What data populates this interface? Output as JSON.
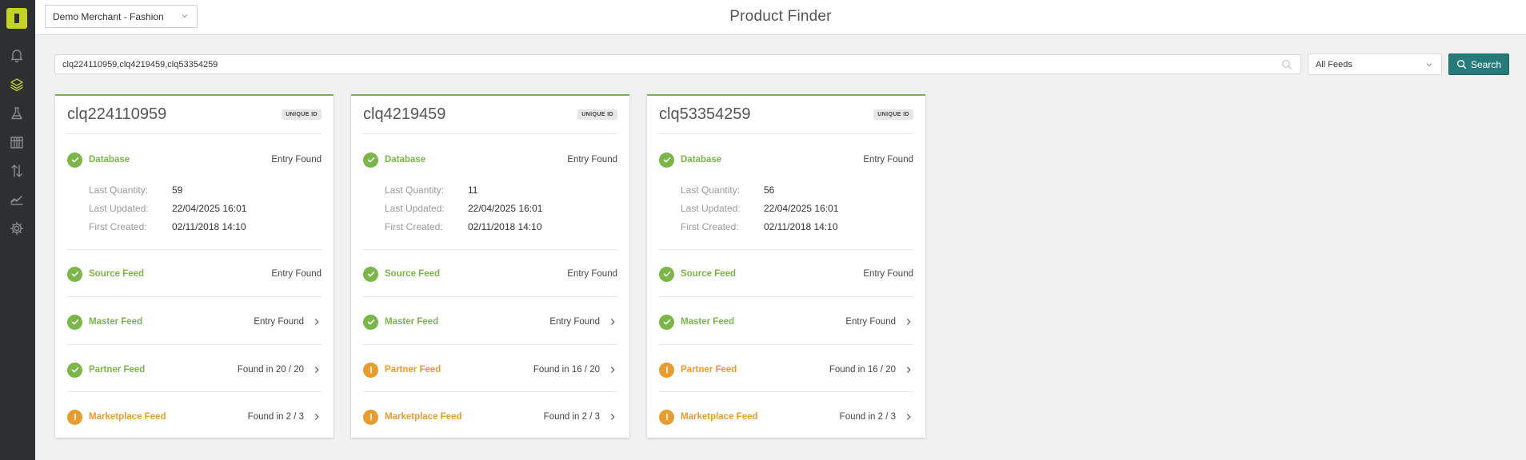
{
  "app": {
    "page_title": "Product Finder"
  },
  "header": {
    "merchant_select": "Demo Merchant - Fashion"
  },
  "search": {
    "query": "clq224110959,clq4219459,clq53354259",
    "feeds_select": "All Feeds",
    "button_label": "Search"
  },
  "colors": {
    "ok": "#7ab648",
    "warn": "#e89b2f",
    "accent": "#267a79",
    "sidebar": "#2e2f31",
    "logo": "#c4d22c"
  },
  "sidebar": {
    "items": [
      {
        "icon": "bell-icon"
      },
      {
        "icon": "layers-icon",
        "active": true
      },
      {
        "icon": "flask-icon"
      },
      {
        "icon": "grid-calendar-icon"
      },
      {
        "icon": "sort-arrows-icon"
      },
      {
        "icon": "chart-area-icon"
      },
      {
        "icon": "gear-icon"
      }
    ]
  },
  "cards": [
    {
      "id": "clq224110959",
      "badge": "UNIQUE ID",
      "database": {
        "label": "Database",
        "status": "ok",
        "value": "Entry Found"
      },
      "details": [
        {
          "k": "Last Quantity:",
          "v": "59"
        },
        {
          "k": "Last Updated:",
          "v": "22/04/2025 16:01"
        },
        {
          "k": "First Created:",
          "v": "02/11/2018 14:10"
        }
      ],
      "source": {
        "label": "Source Feed",
        "status": "ok",
        "value": "Entry Found"
      },
      "master": {
        "label": "Master Feed",
        "status": "ok",
        "value": "Entry Found"
      },
      "partner": {
        "label": "Partner Feed",
        "status": "ok",
        "value": "Found in 20 / 20"
      },
      "marketplace": {
        "label": "Marketplace Feed",
        "status": "warn",
        "value": "Found in 2 / 3"
      }
    },
    {
      "id": "clq4219459",
      "badge": "UNIQUE ID",
      "database": {
        "label": "Database",
        "status": "ok",
        "value": "Entry Found"
      },
      "details": [
        {
          "k": "Last Quantity:",
          "v": "11"
        },
        {
          "k": "Last Updated:",
          "v": "22/04/2025 16:01"
        },
        {
          "k": "First Created:",
          "v": "02/11/2018 14:10"
        }
      ],
      "source": {
        "label": "Source Feed",
        "status": "ok",
        "value": "Entry Found"
      },
      "master": {
        "label": "Master Feed",
        "status": "ok",
        "value": "Entry Found"
      },
      "partner": {
        "label": "Partner Feed",
        "status": "warn",
        "value": "Found in 16 / 20"
      },
      "marketplace": {
        "label": "Marketplace Feed",
        "status": "warn",
        "value": "Found in 2 / 3"
      }
    },
    {
      "id": "clq53354259",
      "badge": "UNIQUE ID",
      "database": {
        "label": "Database",
        "status": "ok",
        "value": "Entry Found"
      },
      "details": [
        {
          "k": "Last Quantity:",
          "v": "56"
        },
        {
          "k": "Last Updated:",
          "v": "22/04/2025 16:01"
        },
        {
          "k": "First Created:",
          "v": "02/11/2018 14:10"
        }
      ],
      "source": {
        "label": "Source Feed",
        "status": "ok",
        "value": "Entry Found"
      },
      "master": {
        "label": "Master Feed",
        "status": "ok",
        "value": "Entry Found"
      },
      "partner": {
        "label": "Partner Feed",
        "status": "warn",
        "value": "Found in 16 / 20"
      },
      "marketplace": {
        "label": "Marketplace Feed",
        "status": "warn",
        "value": "Found in 2 / 3"
      }
    }
  ]
}
